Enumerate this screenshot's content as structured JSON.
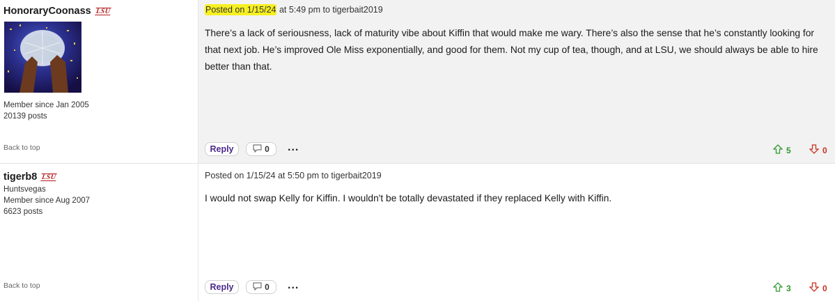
{
  "posts": [
    {
      "username": "HonoraryCoonass",
      "badge": "LSU",
      "location": "",
      "member_since": "Member since Jan 2005",
      "post_count": "20139 posts",
      "back_to_top": "Back to top",
      "posted_highlight": "Posted on 1/15/24",
      "posted_rest": " at 5:49 pm to tigerbait2019",
      "body": "There’s a lack of seriousness, lack of maturity vibe about Kiffin that would make me wary. There’s also the sense that he’s constantly looking for that next job. He’s improved Ole Miss exponentially, and good for them. Not my cup of tea, though, and at LSU, we should always be able to hire better than that.",
      "reply_label": "Reply",
      "comment_count": "0",
      "more": "...",
      "upvotes": "5",
      "downvotes": "0"
    },
    {
      "username": "tigerb8",
      "badge": "LSU",
      "location": "Huntsvegas",
      "member_since": "Member since Aug 2007",
      "post_count": "6623 posts",
      "back_to_top": "Back to top",
      "posted_highlight": "",
      "posted_rest": "Posted on 1/15/24 at 5:50 pm to tigerbait2019",
      "body": "I would not swap Kelly for Kiffin. I wouldn't be totally devastated if they replaced Kelly with Kiffin.",
      "reply_label": "Reply",
      "comment_count": "0",
      "more": "...",
      "upvotes": "3",
      "downvotes": "0"
    }
  ],
  "colors": {
    "highlight": "#f7f021",
    "reply": "#4b2a8a",
    "upvote": "#2e9a2e",
    "downvote": "#c9321f",
    "badge": "#b01818"
  },
  "icons": {
    "comment": "speech-bubble-icon",
    "upvote": "arrow-up-icon",
    "downvote": "arrow-down-icon"
  }
}
